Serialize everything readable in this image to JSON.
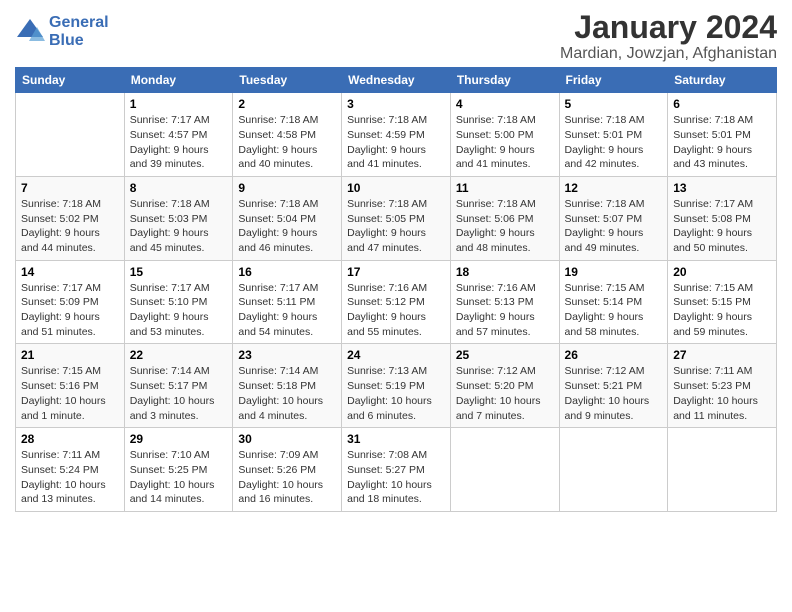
{
  "header": {
    "logo_line1": "General",
    "logo_line2": "Blue",
    "title": "January 2024",
    "subtitle": "Mardian, Jowzjan, Afghanistan"
  },
  "days_of_week": [
    "Sunday",
    "Monday",
    "Tuesday",
    "Wednesday",
    "Thursday",
    "Friday",
    "Saturday"
  ],
  "weeks": [
    [
      {
        "day": "",
        "info": ""
      },
      {
        "day": "1",
        "info": "Sunrise: 7:17 AM\nSunset: 4:57 PM\nDaylight: 9 hours\nand 39 minutes."
      },
      {
        "day": "2",
        "info": "Sunrise: 7:18 AM\nSunset: 4:58 PM\nDaylight: 9 hours\nand 40 minutes."
      },
      {
        "day": "3",
        "info": "Sunrise: 7:18 AM\nSunset: 4:59 PM\nDaylight: 9 hours\nand 41 minutes."
      },
      {
        "day": "4",
        "info": "Sunrise: 7:18 AM\nSunset: 5:00 PM\nDaylight: 9 hours\nand 41 minutes."
      },
      {
        "day": "5",
        "info": "Sunrise: 7:18 AM\nSunset: 5:01 PM\nDaylight: 9 hours\nand 42 minutes."
      },
      {
        "day": "6",
        "info": "Sunrise: 7:18 AM\nSunset: 5:01 PM\nDaylight: 9 hours\nand 43 minutes."
      }
    ],
    [
      {
        "day": "7",
        "info": "Sunrise: 7:18 AM\nSunset: 5:02 PM\nDaylight: 9 hours\nand 44 minutes."
      },
      {
        "day": "8",
        "info": "Sunrise: 7:18 AM\nSunset: 5:03 PM\nDaylight: 9 hours\nand 45 minutes."
      },
      {
        "day": "9",
        "info": "Sunrise: 7:18 AM\nSunset: 5:04 PM\nDaylight: 9 hours\nand 46 minutes."
      },
      {
        "day": "10",
        "info": "Sunrise: 7:18 AM\nSunset: 5:05 PM\nDaylight: 9 hours\nand 47 minutes."
      },
      {
        "day": "11",
        "info": "Sunrise: 7:18 AM\nSunset: 5:06 PM\nDaylight: 9 hours\nand 48 minutes."
      },
      {
        "day": "12",
        "info": "Sunrise: 7:18 AM\nSunset: 5:07 PM\nDaylight: 9 hours\nand 49 minutes."
      },
      {
        "day": "13",
        "info": "Sunrise: 7:17 AM\nSunset: 5:08 PM\nDaylight: 9 hours\nand 50 minutes."
      }
    ],
    [
      {
        "day": "14",
        "info": "Sunrise: 7:17 AM\nSunset: 5:09 PM\nDaylight: 9 hours\nand 51 minutes."
      },
      {
        "day": "15",
        "info": "Sunrise: 7:17 AM\nSunset: 5:10 PM\nDaylight: 9 hours\nand 53 minutes."
      },
      {
        "day": "16",
        "info": "Sunrise: 7:17 AM\nSunset: 5:11 PM\nDaylight: 9 hours\nand 54 minutes."
      },
      {
        "day": "17",
        "info": "Sunrise: 7:16 AM\nSunset: 5:12 PM\nDaylight: 9 hours\nand 55 minutes."
      },
      {
        "day": "18",
        "info": "Sunrise: 7:16 AM\nSunset: 5:13 PM\nDaylight: 9 hours\nand 57 minutes."
      },
      {
        "day": "19",
        "info": "Sunrise: 7:15 AM\nSunset: 5:14 PM\nDaylight: 9 hours\nand 58 minutes."
      },
      {
        "day": "20",
        "info": "Sunrise: 7:15 AM\nSunset: 5:15 PM\nDaylight: 9 hours\nand 59 minutes."
      }
    ],
    [
      {
        "day": "21",
        "info": "Sunrise: 7:15 AM\nSunset: 5:16 PM\nDaylight: 10 hours\nand 1 minute."
      },
      {
        "day": "22",
        "info": "Sunrise: 7:14 AM\nSunset: 5:17 PM\nDaylight: 10 hours\nand 3 minutes."
      },
      {
        "day": "23",
        "info": "Sunrise: 7:14 AM\nSunset: 5:18 PM\nDaylight: 10 hours\nand 4 minutes."
      },
      {
        "day": "24",
        "info": "Sunrise: 7:13 AM\nSunset: 5:19 PM\nDaylight: 10 hours\nand 6 minutes."
      },
      {
        "day": "25",
        "info": "Sunrise: 7:12 AM\nSunset: 5:20 PM\nDaylight: 10 hours\nand 7 minutes."
      },
      {
        "day": "26",
        "info": "Sunrise: 7:12 AM\nSunset: 5:21 PM\nDaylight: 10 hours\nand 9 minutes."
      },
      {
        "day": "27",
        "info": "Sunrise: 7:11 AM\nSunset: 5:23 PM\nDaylight: 10 hours\nand 11 minutes."
      }
    ],
    [
      {
        "day": "28",
        "info": "Sunrise: 7:11 AM\nSunset: 5:24 PM\nDaylight: 10 hours\nand 13 minutes."
      },
      {
        "day": "29",
        "info": "Sunrise: 7:10 AM\nSunset: 5:25 PM\nDaylight: 10 hours\nand 14 minutes."
      },
      {
        "day": "30",
        "info": "Sunrise: 7:09 AM\nSunset: 5:26 PM\nDaylight: 10 hours\nand 16 minutes."
      },
      {
        "day": "31",
        "info": "Sunrise: 7:08 AM\nSunset: 5:27 PM\nDaylight: 10 hours\nand 18 minutes."
      },
      {
        "day": "",
        "info": ""
      },
      {
        "day": "",
        "info": ""
      },
      {
        "day": "",
        "info": ""
      }
    ]
  ]
}
